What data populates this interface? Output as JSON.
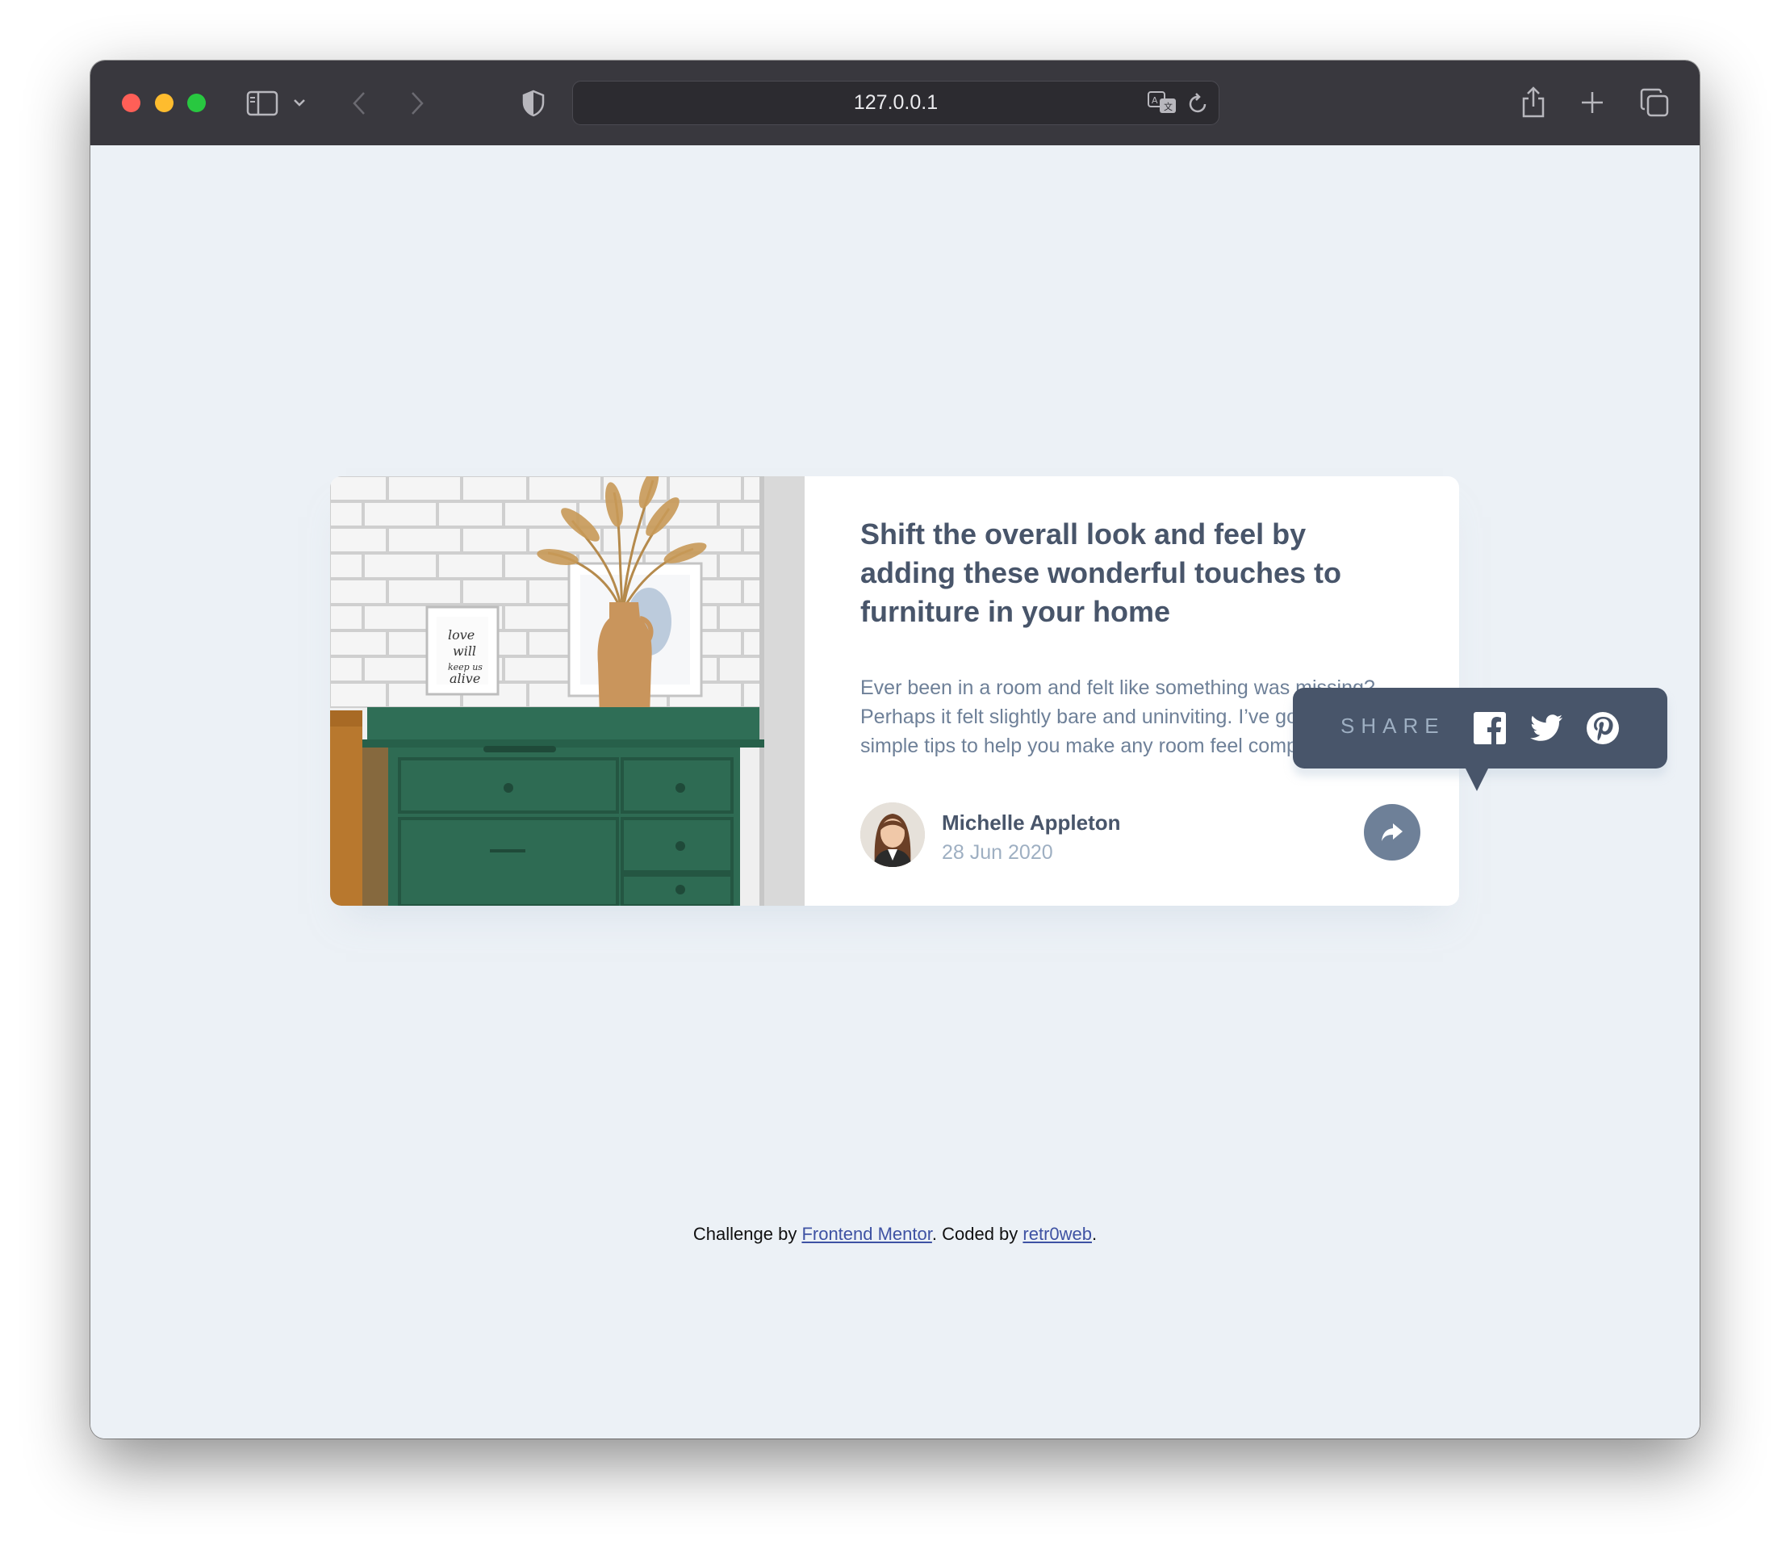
{
  "browser": {
    "url": "127.0.0.1",
    "icons": [
      "sidebar-icon",
      "chevron-down-icon",
      "back-icon",
      "forward-icon",
      "shield-icon",
      "translate-icon",
      "reload-icon",
      "share-icon",
      "plus-icon",
      "tabs-icon"
    ]
  },
  "article": {
    "title": "Shift the overall look and feel by adding these wonderful touches to furniture in your home",
    "description": "Ever been in a room and felt like something was missing? Perhaps it felt slightly bare and uninviting. I’ve got some simple tips to help you make any room feel complete.",
    "author_name": "Michelle Appleton",
    "date": "28 Jun 2020"
  },
  "share": {
    "label": "SHARE",
    "networks": [
      "facebook-icon",
      "twitter-icon",
      "pinterest-icon"
    ]
  },
  "footer": {
    "prefix": "Challenge by ",
    "link1": "Frontend Mentor",
    "middle": ". Coded by ",
    "link2": "retr0web",
    "suffix": "."
  },
  "colors": {
    "page_bg": "#ecf1f6",
    "title": "#48556a",
    "body_text": "#6e8098",
    "muted": "#9eafc2",
    "tooltip_bg": "#48556a",
    "link": "#3e52a3"
  }
}
